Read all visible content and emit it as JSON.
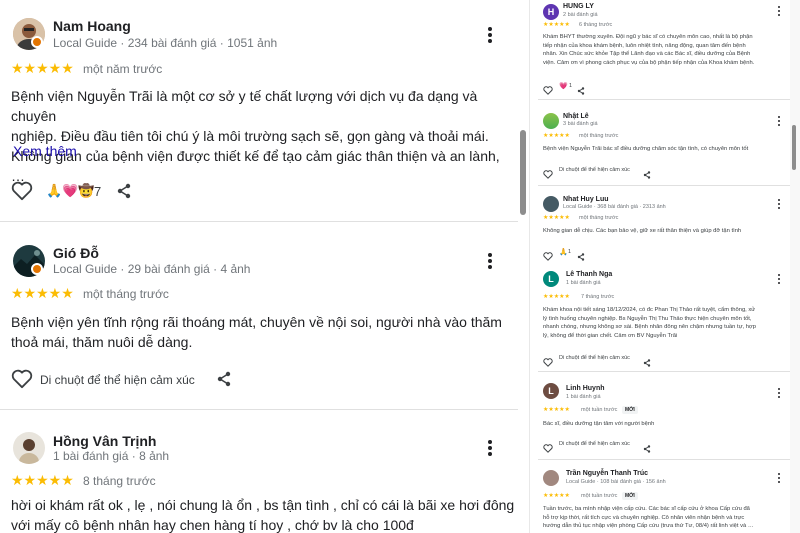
{
  "left_reviews": [
    {
      "name": "Nam Hoang",
      "meta": "Local Guide · 234 bài đánh giá · 1051 ảnh",
      "stars": "★★★★★",
      "time": "một năm trước",
      "text_lines": [
        "Bệnh viện Nguyễn Trãi là một cơ sở y tế chất lượng với dịch vụ đa dạng và chuyên",
        "nghiệp. Điều đầu tiên tôi chú ý là môi trường sạch sẽ, gọn gàng và thoải mái.",
        "Không gian của bệnh viện được thiết kế để tạo cảm giác thân thiện và an lành, …"
      ],
      "more": "Xem thêm",
      "reactions": "🙏💗🤠",
      "reaction_count": "7"
    },
    {
      "name": "Gió Đỗ",
      "meta": "Local Guide · 29 bài đánh giá · 4 ảnh",
      "stars": "★★★★★",
      "time": "một tháng trước",
      "text_lines": [
        "Bệnh viện yên tĩnh rộng rãi thoáng mát, chuyên về nội soi, người nhà vào thăm",
        "thoả mái, thăm nuôi dễ dàng."
      ],
      "hint": "Di chuột để thể hiện cảm xúc"
    },
    {
      "name": "Hồng Vân Trịnh",
      "meta": "1 bài đánh giá · 8 ảnh",
      "stars": "★★★★★",
      "time": "8 tháng trước",
      "text_lines": [
        "hời oi khám rất ok , lẹ , nói chung là ổn , bs tận tình , chỉ có cái là bãi xe hơi đông",
        "với mấy cô bệnh nhân hay chen hàng tí hoy , chớ bv là cho 100đ"
      ]
    }
  ],
  "right_reviews": [
    {
      "initial": "H",
      "color": "#5e35b1",
      "name": "HUNG LY",
      "meta": "2 bài đánh giá",
      "stars": "★★★★★",
      "time": "6 tháng trước",
      "text_lines": [
        "Khám BHYT thường xuyên. Đội ngũ y bác sĩ có chuyên môn cao, nhất là bộ phận",
        "tiếp nhận của khoa khám bệnh, luôn nhiệt tình, năng động, quan tâm đến bệnh",
        "nhân. Xin Chúc sức khỏe Tập thể Lãnh đạo và các Bác sĩ, điều dưỡng của Bệnh",
        "viện. Cảm ơn vì phong cách phục vụ của bộ phận tiếp nhận của Khoa khám bệnh."
      ],
      "reaction": "💗",
      "reaction_count": "1"
    },
    {
      "initial": "",
      "color": "#4caf50",
      "name": "Nhật Lê",
      "meta": "3 bài đánh giá",
      "stars": "★★★★★",
      "time": "một tháng trước",
      "text_lines": [
        "Bệnh viện Nguyễn Trãi bác sĩ điều dưỡng chăm sóc tận tình, có chuyên môn tốt"
      ],
      "hint": "Di chuột để thể hiện cảm xúc"
    },
    {
      "initial": "",
      "color": "#607d8b",
      "name": "Nhat Huy Luu",
      "meta": "Local Guide · 368 bài đánh giá · 2313 ảnh",
      "stars": "★★★★★",
      "time": "một tháng trước",
      "text_lines": [
        "Không gian dễ chịu. Các bạn bảo vệ, giữ xe rất thân thiện và giúp đỡ tận tình"
      ],
      "reaction": "🙏",
      "reaction_count": "1"
    },
    {
      "initial": "L",
      "color": "#00897b",
      "name": "Lê Thanh Nga",
      "meta": "1 bài đánh giá",
      "stars": "★★★★★",
      "time": "7 tháng trước",
      "text_lines": [
        "Khám khoa nội tiết sáng 18/12/2024, có đc Phan Thị Thảo rất tuyệt, cẩm thông, xử",
        "lý tình huống chuyên nghiệp. Bs Nguyễn Thị Thu Thảo thực hiện chuyên môn tốt,",
        "nhanh chóng, nhưng không sơ sài. Bệnh nhân đông nên chậm nhưng tuần tự, hợp",
        "lý, không để thời gian chết. Cảm ơn BV Nguyễn Trãi"
      ],
      "hint": "Di chuột để thể hiện cảm xúc"
    },
    {
      "initial": "L",
      "color": "#6d4c41",
      "name": "Linh Huynh",
      "meta": "1 bài đánh giá",
      "stars": "★★★★★",
      "time": "một tuần trước",
      "badge": "MỚI",
      "text_lines": [
        "Bác sĩ, điều dưỡng tận tâm với người bệnh"
      ],
      "hint": "Di chuột để thể hiện cảm xúc"
    },
    {
      "initial": "",
      "color": "#8d6e63",
      "name": "Trần Nguyễn Thanh Trúc",
      "meta": "Local Guide · 108 bài đánh giá · 156 ảnh",
      "stars": "★★★★★",
      "time": "một tuần trước",
      "badge": "MỚI",
      "text_lines": [
        "Tuần trước, ba mình nhập viện cấp cứu. Các bác sĩ cấp cứu ở khoa Cấp cứu đã",
        "hỗ trợ kịp thời, rất tích cực và chuyên nghiệp. Cô nhân viên nhận bệnh và trực",
        "hướng dẫn thủ tục nhập viện phòng Cấp cứu (trưa thứ Tư, 08/4) rất linh việt và …"
      ]
    }
  ]
}
